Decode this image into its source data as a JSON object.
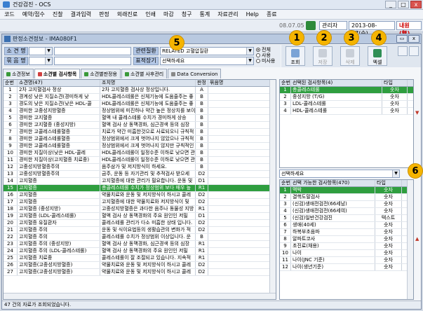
{
  "app": {
    "title": "건강검진 - OCS"
  },
  "window_controls": [
    "_",
    "□",
    "x"
  ],
  "menu": [
    "코드",
    "예약/접수",
    "진찰",
    "결과입력",
    "판정",
    "외래진료",
    "인쇄",
    "마감",
    "청구",
    "통계",
    "자료관리",
    "Help",
    "종료"
  ],
  "toolbar": {
    "version": "08.07.05",
    "user": "관리자",
    "date": "2013-08-07(수)",
    "status": "내원(無)"
  },
  "window": {
    "title": "판정소견정보 - IMA080F1",
    "controls": [
      "▭",
      "x"
    ]
  },
  "filter": {
    "label_sogyeon": "소 견 명",
    "label_mukeum": "묶 음 명",
    "label_relation": "관련질환",
    "relation_value": "RELATED 고혈압질환",
    "label_pyojeok": "표적장기",
    "pyojeok_value": "선택하세요",
    "radio": [
      "전체",
      "사용",
      "미사용"
    ]
  },
  "buttons": [
    {
      "label": "조회",
      "badge": "1"
    },
    {
      "label": "저장",
      "badge": "2"
    },
    {
      "label": "삭제",
      "badge": "3"
    },
    {
      "label": "엑셀",
      "badge": "4"
    }
  ],
  "badge5": "5",
  "badge6": "6",
  "tabs": [
    "소견정보",
    "소견별 검사항목",
    "소견별판정용",
    "소견별 사후관리",
    "Data Conversion"
  ],
  "main_grid": {
    "headers": [
      "순번",
      "소견명(47)",
      "조치명",
      "판정",
      "묶음명"
    ],
    "rows": [
      [
        "1",
        "2차 고지혈검사 정상",
        "2차 고지혈증 검사상 정상입니다.",
        "A",
        ""
      ],
      [
        "2",
        "경계성 낮은 지질소견(경미하게 낮",
        "HDL콜레스테롤은 신체기능에 도움줄주는 좋",
        "B",
        ""
      ],
      [
        "3",
        "경도의 낮은 지질소견(낮은 HDL-콜",
        "HDL콜레스테롤은 신체기능에 도움줄주는 좋",
        "B",
        ""
      ],
      [
        "4",
        "경미한 고중성지방혈증",
        "정상범위에 미진하나 약간 높은 정상치를 보이",
        "B",
        ""
      ],
      [
        "5",
        "경미한 고지혈증",
        "혈액 내 콜레스테롤 수치가 경미하게 상승",
        "B",
        ""
      ],
      [
        "6",
        "경미한 고지혈증 (중성지방)",
        "혈액 검사 상 동맥경화, 심근경색 등의 심장",
        "B",
        ""
      ],
      [
        "7",
        "경미한 고콜레스테롤혈증",
        "치료가 약간 미흡한것으로 사료되오니 규칙적",
        "B",
        ""
      ],
      [
        "8",
        "경미한 고콜레스테롤혈증",
        "정상범위에서 크게 벗어나지 않았으나 규칙적",
        "B",
        ""
      ],
      [
        "9",
        "경미한 고콜레스테롤혈증",
        "정상범위에서 크게 벗어나지 않지만 규칙적인",
        "B",
        ""
      ],
      [
        "10",
        "경미한 지질이상(낮은 HDL-콜레",
        "HDL콜레스테롤이 일정수준 이하로 낮으면 관",
        "B",
        ""
      ],
      [
        "11",
        "경미한 지질이상(고지혈증 치료중)",
        "HDL콜레스테롤이 일정수준 이하로 낮으면 관",
        "B",
        ""
      ],
      [
        "12",
        "고중성지방혈증주의",
        "음주삼가 및 저지방식이 하세요.",
        "B",
        ""
      ],
      [
        "13",
        "고중성지방혈증주의",
        "금주, 운동 등 자기관리 및 추적검사 받으세",
        "D2",
        ""
      ],
      [
        "14",
        "고지혈증",
        "고지혈증에 대한 관리가 필요합니다. 운동 및",
        "D1",
        ""
      ],
      [
        "15",
        "고지혈증",
        "총콜레스테롤 수치가 정상범위 보다 매우 높",
        "R1",
        ""
      ],
      [
        "16",
        "고지혈증",
        "약물치료와 운동 및 저지방식이 하시고 콜레",
        "D2",
        ""
      ],
      [
        "17",
        "고지혈증",
        "고지혈증에 대한 약물치료와 저지방식이 및",
        "D2",
        ""
      ],
      [
        "18",
        "고지혈증 (중성지방)",
        "고중성지방혈증은 과다한 음주나 동물성 지방",
        "R1",
        ""
      ],
      [
        "19",
        "고지혈증 (LDL-콜레스테롤)",
        "혈액 검사 상 동맥경화의 주요 원인인 저밀",
        "D1",
        ""
      ],
      [
        "20",
        "고지혈증 유질환자",
        "콜레스테롤 관리가 다소 미흡한 상태 입니다.",
        "D2",
        ""
      ],
      [
        "21",
        "고지혈증 주의",
        "운동 및 식이요법등의 생활습관의 변화가 적",
        "D2",
        ""
      ],
      [
        "22",
        "고지혈증 주의",
        "콜레스테롤 수치가 정상범위 이상입니다. 운",
        "B",
        ""
      ],
      [
        "23",
        "고지혈증 주의 (중성지방)",
        "혈액 검사 상 동맥경화, 심근경색 등의 심장",
        "R1",
        ""
      ],
      [
        "24",
        "고지혈증 주의 (LDL-콜레스테롤)",
        "혈액 검사 상 동맥경화의 주요 원인인 저밀",
        "R1",
        ""
      ],
      [
        "25",
        "고지혈증 치료중",
        "콜레스테롤이 잘 조절되고 있습니다. 지속적",
        "R1",
        ""
      ],
      [
        "26",
        "고지혈증(고중성지방혈증)",
        "약물치료와 운동 및 저지방식이 하시고 콜레",
        "D2",
        ""
      ],
      [
        "27",
        "고지혈증(고중성지방혈증)",
        "약물치료와 운동 및 저지방식이 하시고 콜레",
        "D2",
        ""
      ]
    ]
  },
  "right_top_grid": {
    "headers": [
      "순번",
      "선택된 검사항목(4)",
      "타입"
    ],
    "rows": [
      [
        "1",
        "총콜레스테롤",
        "숫자"
      ],
      [
        "2",
        "중성지방 (T/G)",
        "숫자"
      ],
      [
        "3",
        "LDL-콜레스테롤",
        "숫자"
      ],
      [
        "4",
        "HDL-콜레스테롤",
        "숫자"
      ]
    ]
  },
  "right_select": "선택하세요",
  "right_bottom_grid": {
    "headers": [
      "순번",
      "선택 가능한 검사항목(470)",
      "타입"
    ],
    "rows": [
      [
        "1",
        "맥박",
        "숫자"
      ],
      [
        "2",
        "결핵도말검사",
        "숫자"
      ],
      [
        "3",
        "(신검)생애전검전(66세남)",
        "숫자"
      ],
      [
        "4",
        "(신검)생애전검전(66세여)",
        "숫자"
      ],
      [
        "5",
        "(신검)일반건강검진",
        "텍스트"
      ],
      [
        "6",
        "생애(40세)",
        "숫자"
      ],
      [
        "7",
        "하복부초음파",
        "숫자"
      ],
      [
        "8",
        "알파트코사",
        "숫자"
      ],
      [
        "9",
        "초진료(채용)",
        "숫자"
      ],
      [
        "10",
        "나이",
        "숫자"
      ],
      [
        "11",
        "나이(JNC 기준)",
        "숫자"
      ],
      [
        "12",
        "나이(생년기준)",
        "숫자"
      ]
    ]
  },
  "status": "47 건의 자료가 조회되었습니다."
}
